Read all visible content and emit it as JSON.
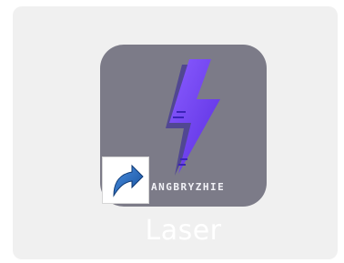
{
  "desktop_shortcut": {
    "label": "Laser",
    "logo_text": "ANGBRYZHIE",
    "icon": "lightning-bolt-icon",
    "overlay_icon": "shortcut-arrow-icon",
    "colors": {
      "icon_background": "#7c7b88",
      "bolt": "#6a3cf0",
      "tile_background": "#f0f0f0",
      "arrow": "#1f5fae"
    }
  }
}
